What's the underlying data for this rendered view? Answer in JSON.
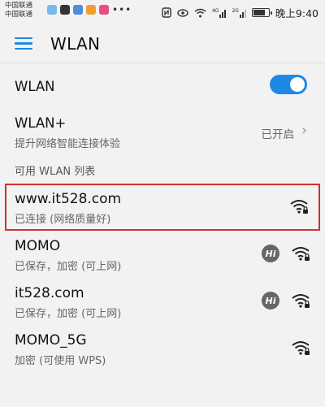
{
  "status_bar": {
    "carrier_1": "中国联通",
    "carrier_2": "中国联通",
    "app_colors": [
      "#7ab8e8",
      "#333333",
      "#4a90d9",
      "#f0a030",
      "#e85080"
    ],
    "more": "•••",
    "signal_label_1": "4G",
    "signal_label_2": "2G",
    "time": "晚上9:40",
    "battery_level": 0.8
  },
  "app_bar": {
    "title": "WLAN",
    "menu_icon": "menu-icon"
  },
  "wlan_toggle": {
    "label": "WLAN",
    "enabled": true,
    "accent": "#1e88e5"
  },
  "wlan_plus": {
    "title": "WLAN+",
    "subtitle": "提升网络智能连接体验",
    "status": "已开启"
  },
  "section_header": "可用 WLAN 列表",
  "networks": [
    {
      "name": "www.it528.com",
      "status": "已连接 (网络质量好)",
      "hi": false
    },
    {
      "name": "MOMO",
      "status": "已保存，加密 (可上网)",
      "hi": true
    },
    {
      "name": "it528.com",
      "status": "已保存，加密 (可上网)",
      "hi": true
    },
    {
      "name": "MOMO_5G",
      "status": "加密 (可使用 WPS)",
      "hi": false
    }
  ],
  "hi_label": "Hi",
  "highlight_color": "#d32f2f"
}
